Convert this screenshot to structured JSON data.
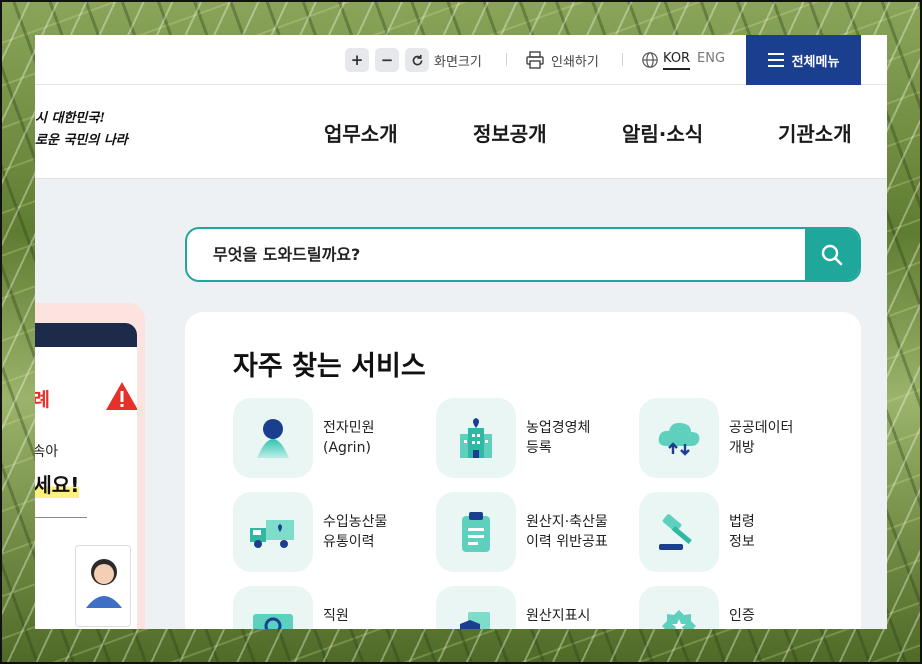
{
  "utility": {
    "zoom_in": "+",
    "zoom_out": "−",
    "reset": "C",
    "zoom_label": "화면크기",
    "print_label": "인쇄하기",
    "lang_kor": "KOR",
    "lang_eng": "ENG",
    "all_menu": "전체메뉴"
  },
  "slogan": {
    "line1": "시 대한민국!",
    "line2": "로운 국민의 나라"
  },
  "gnb": [
    "업무소개",
    "정보공개",
    "알림·소식",
    "기관소개"
  ],
  "search": {
    "placeholder": "무엇을 도와드릴까요?"
  },
  "banner": {
    "title": "하례",
    "line1": "에 속아",
    "line2": "하세요!"
  },
  "services": {
    "title": "자주 찾는 서비스",
    "items": [
      {
        "label": "전자민원\n(Agrin)",
        "icon": "person-icon"
      },
      {
        "label": "농업경영체\n등록",
        "icon": "building-icon"
      },
      {
        "label": "공공데이터\n개방",
        "icon": "cloud-icon"
      },
      {
        "label": "수입농산물\n유통이력",
        "icon": "truck-icon"
      },
      {
        "label": "원산지·축산물\n이력 위반공표",
        "icon": "clipboard-icon"
      },
      {
        "label": "법령\n정보",
        "icon": "gavel-icon"
      },
      {
        "label": "직원",
        "icon": "id-card-icon"
      },
      {
        "label": "원산지표시",
        "icon": "document-shield-icon"
      },
      {
        "label": "인증",
        "icon": "badge-icon"
      }
    ]
  },
  "colors": {
    "brand_blue": "#1b3f8f",
    "accent_teal": "#1fa79b",
    "alert_red": "#e5312a"
  }
}
